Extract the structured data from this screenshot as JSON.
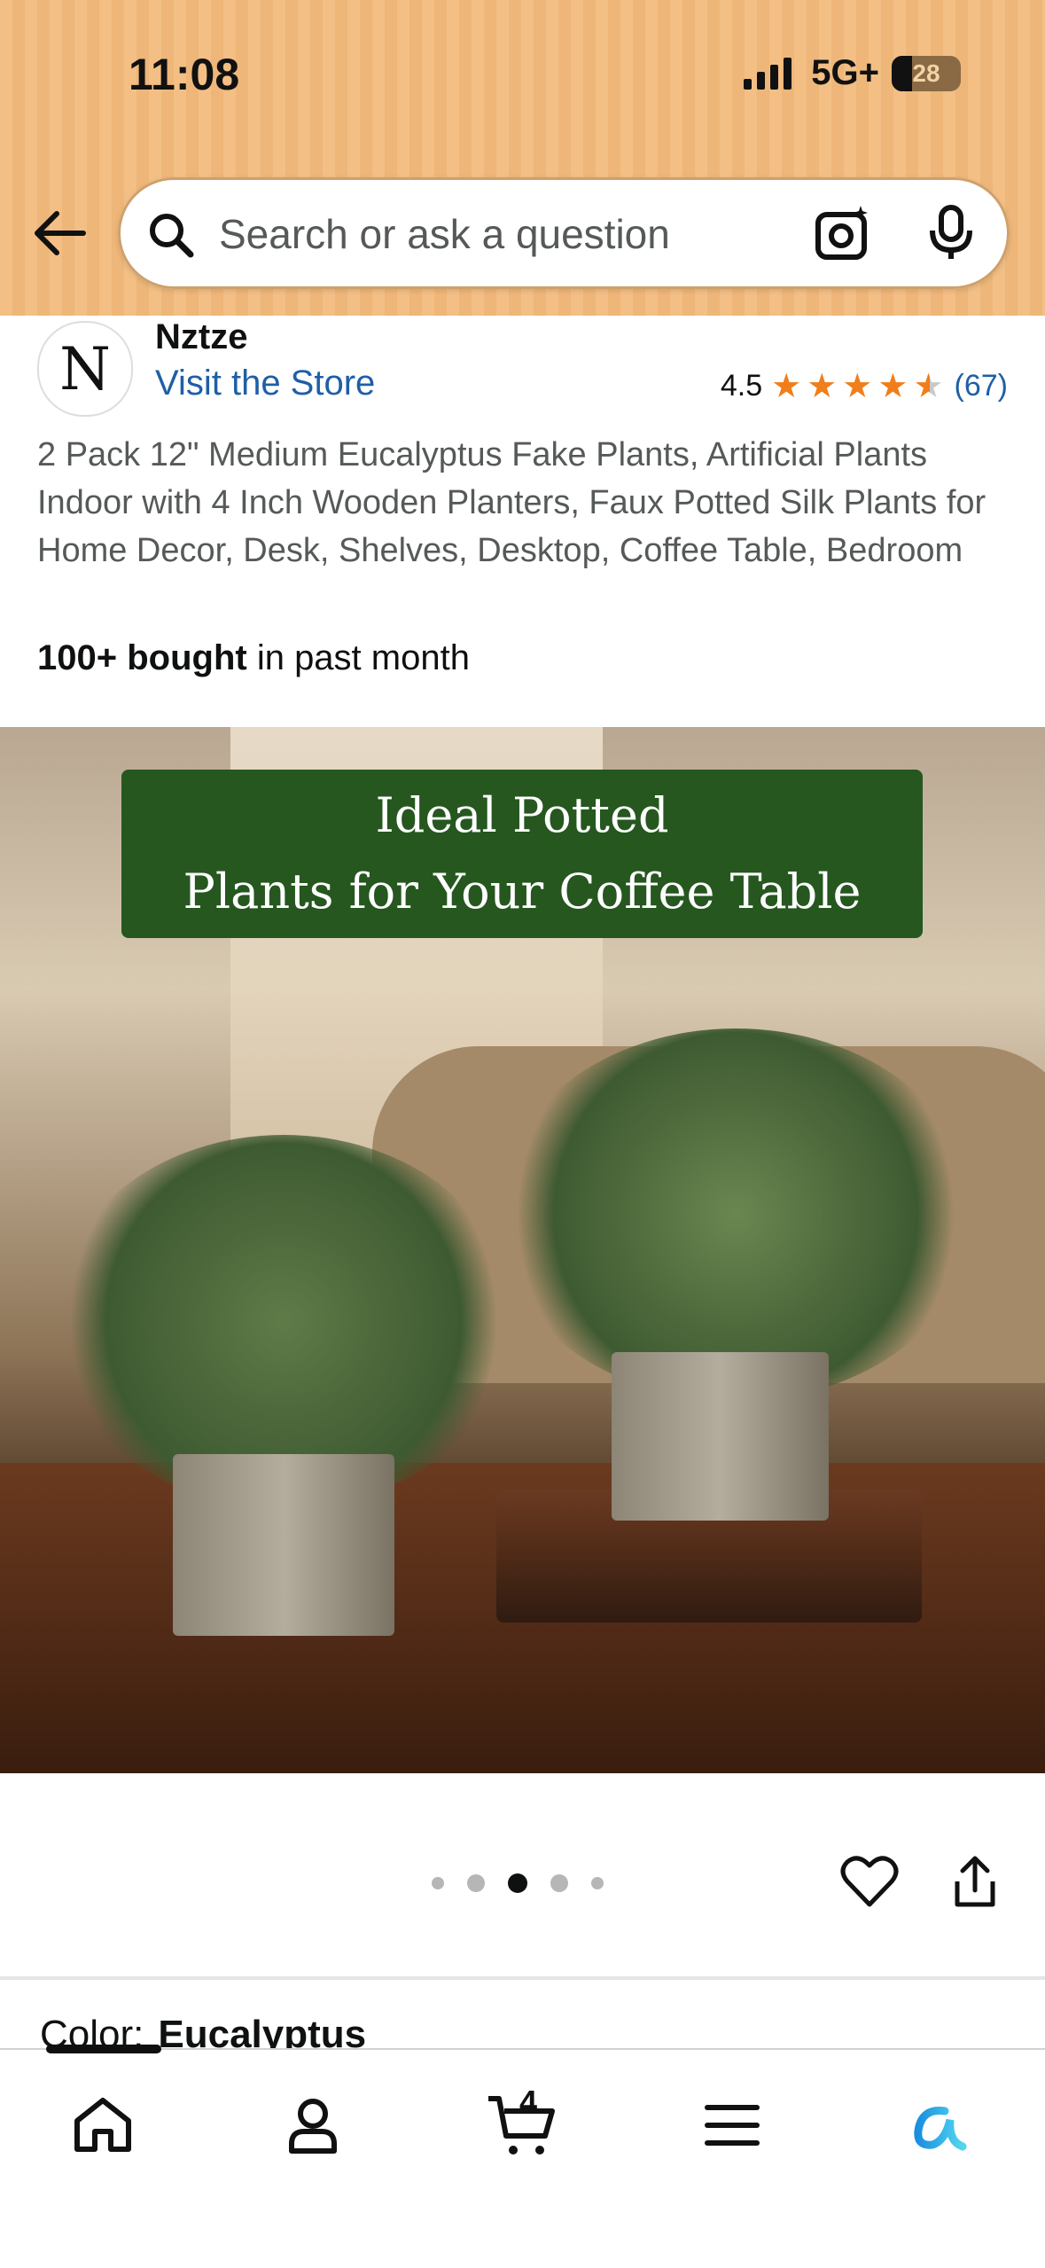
{
  "status_bar": {
    "time": "11:08",
    "network": "5G+",
    "battery": "28"
  },
  "search": {
    "placeholder": "Search or ask a question"
  },
  "product": {
    "brand": "Nztze",
    "brand_logo_glyph": "N",
    "store_link": "Visit the Store",
    "rating": "4.5",
    "rating_value": 4.5,
    "review_count": "(67)",
    "title": "2 Pack 12\" Medium Eucalyptus Fake Plants, Artificial Plants Indoor with 4 Inch Wooden Planters, Faux Potted Silk Plants for Home Decor, Desk, Shelves, Desktop, Coffee Table, Bedroom",
    "bought_bold": "100+ bought",
    "bought_rest": " in past month",
    "image_banner_line1": "Ideal Potted",
    "image_banner_line2": "Plants for Your Coffee Table",
    "image_index": 3,
    "image_total": 5,
    "color_label": "Color:",
    "color_value": "Eucalyptus"
  },
  "bottom_nav": {
    "cart_count": "4",
    "items": [
      "home-icon",
      "account-icon",
      "cart-icon",
      "menu-icon",
      "rufus-icon"
    ]
  },
  "colors": {
    "header_bg": "#f3bf85",
    "link": "#1f5fa6",
    "star": "#f07e1a",
    "banner_bg": "#25571f"
  }
}
